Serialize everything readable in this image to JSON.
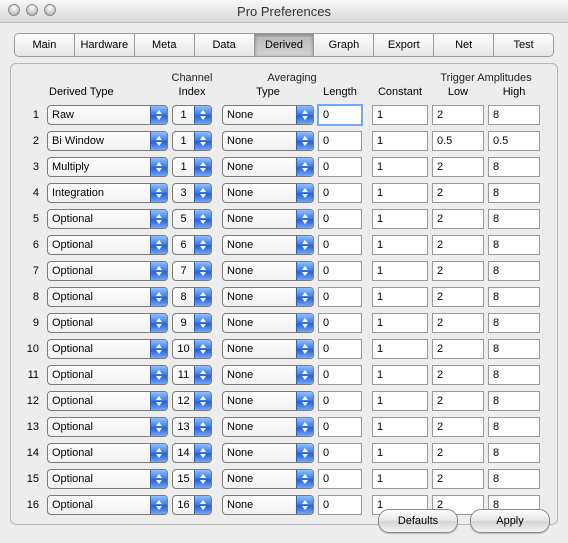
{
  "window": {
    "title": "Pro Preferences"
  },
  "tabs": [
    "Main",
    "Hardware",
    "Meta",
    "Data",
    "Derived",
    "Graph",
    "Export",
    "Net",
    "Test"
  ],
  "active_tab": 4,
  "columns": {
    "derived_type": "Derived Type",
    "channel_index": "Channel\nIndex",
    "avg_group": "Averaging",
    "avg_type": "Type",
    "avg_length": "Length",
    "constant": "Constant",
    "trig_group": "Trigger Amplitudes",
    "trig_low": "Low",
    "trig_high": "High"
  },
  "rows": [
    {
      "n": "1",
      "derived": "Raw",
      "chidx": "1",
      "avgtype": "None",
      "avglen": "0",
      "const": "1",
      "low": "2",
      "high": "8",
      "focus": true
    },
    {
      "n": "2",
      "derived": "Bi Window",
      "chidx": "1",
      "avgtype": "None",
      "avglen": "0",
      "const": "1",
      "low": "0.5",
      "high": "0.5"
    },
    {
      "n": "3",
      "derived": "Multiply",
      "chidx": "1",
      "avgtype": "None",
      "avglen": "0",
      "const": "1",
      "low": "2",
      "high": "8"
    },
    {
      "n": "4",
      "derived": "Integration",
      "chidx": "3",
      "avgtype": "None",
      "avglen": "0",
      "const": "1",
      "low": "2",
      "high": "8"
    },
    {
      "n": "5",
      "derived": "Optional",
      "chidx": "5",
      "avgtype": "None",
      "avglen": "0",
      "const": "1",
      "low": "2",
      "high": "8"
    },
    {
      "n": "6",
      "derived": "Optional",
      "chidx": "6",
      "avgtype": "None",
      "avglen": "0",
      "const": "1",
      "low": "2",
      "high": "8"
    },
    {
      "n": "7",
      "derived": "Optional",
      "chidx": "7",
      "avgtype": "None",
      "avglen": "0",
      "const": "1",
      "low": "2",
      "high": "8"
    },
    {
      "n": "8",
      "derived": "Optional",
      "chidx": "8",
      "avgtype": "None",
      "avglen": "0",
      "const": "1",
      "low": "2",
      "high": "8"
    },
    {
      "n": "9",
      "derived": "Optional",
      "chidx": "9",
      "avgtype": "None",
      "avglen": "0",
      "const": "1",
      "low": "2",
      "high": "8"
    },
    {
      "n": "10",
      "derived": "Optional",
      "chidx": "10",
      "avgtype": "None",
      "avglen": "0",
      "const": "1",
      "low": "2",
      "high": "8"
    },
    {
      "n": "11",
      "derived": "Optional",
      "chidx": "11",
      "avgtype": "None",
      "avglen": "0",
      "const": "1",
      "low": "2",
      "high": "8"
    },
    {
      "n": "12",
      "derived": "Optional",
      "chidx": "12",
      "avgtype": "None",
      "avglen": "0",
      "const": "1",
      "low": "2",
      "high": "8"
    },
    {
      "n": "13",
      "derived": "Optional",
      "chidx": "13",
      "avgtype": "None",
      "avglen": "0",
      "const": "1",
      "low": "2",
      "high": "8"
    },
    {
      "n": "14",
      "derived": "Optional",
      "chidx": "14",
      "avgtype": "None",
      "avglen": "0",
      "const": "1",
      "low": "2",
      "high": "8"
    },
    {
      "n": "15",
      "derived": "Optional",
      "chidx": "15",
      "avgtype": "None",
      "avglen": "0",
      "const": "1",
      "low": "2",
      "high": "8"
    },
    {
      "n": "16",
      "derived": "Optional",
      "chidx": "16",
      "avgtype": "None",
      "avglen": "0",
      "const": "1",
      "low": "2",
      "high": "8"
    }
  ],
  "buttons": {
    "defaults": "Defaults",
    "apply": "Apply"
  }
}
